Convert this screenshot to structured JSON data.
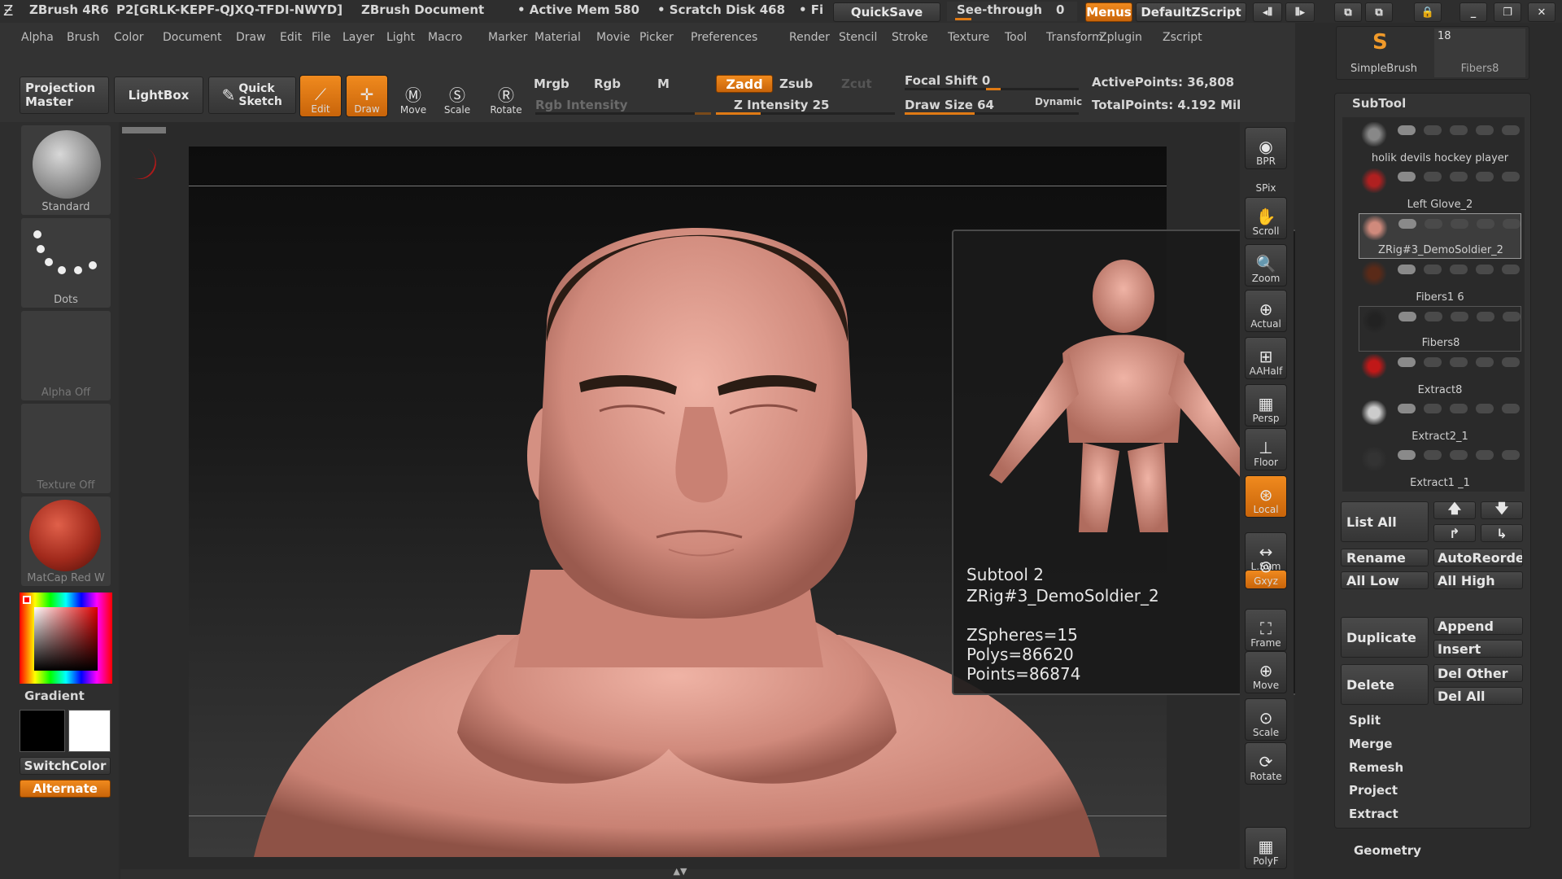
{
  "titlebar": {
    "app": "ZBrush 4R6",
    "serial": "P2[GRLK-KEPF-QJXQ-TFDI-NWYD]",
    "document": "ZBrush Document",
    "active_mem": "• Active Mem 580",
    "scratch": "• Scratch Disk 468",
    "fi": "• Fi",
    "quicksave": "QuickSave",
    "seethrough": "See-through",
    "seethrough_val": "0",
    "menus": "Menus",
    "script": "DefaultZScript"
  },
  "menubar": [
    "Alpha",
    "Brush",
    "Color",
    "Document",
    "Draw",
    "Edit",
    "File",
    "Layer",
    "Light",
    "Macro",
    "Marker",
    "Material",
    "Movie",
    "Picker",
    "Preferences",
    "Render",
    "Stencil",
    "Stroke",
    "Texture",
    "Tool",
    "Transform",
    "Zplugin",
    "Zscript"
  ],
  "toolbar": {
    "projection_master": "Projection Master",
    "lightbox": "LightBox",
    "quick_sketch": "Quick Sketch",
    "edit": "Edit",
    "draw": "Draw",
    "move": "Move",
    "scale": "Scale",
    "rotate": "Rotate",
    "mrgb": "Mrgb",
    "rgb": "Rgb",
    "m": "M",
    "rgb_intensity": "Rgb Intensity",
    "zadd": "Zadd",
    "zsub": "Zsub",
    "zcut": "Zcut",
    "z_intensity": "Z Intensity 25",
    "focal_shift": "Focal Shift 0",
    "draw_size": "Draw Size 64",
    "dynamic": "Dynamic",
    "active_points": "ActivePoints: 36,808",
    "total_points": "TotalPoints: 4.192 Mil",
    "z_intensity_level": 0.25,
    "draw_size_level": 0.4
  },
  "leftshelf": {
    "brush": "Standard",
    "stroke": "Dots",
    "alpha": "Alpha Off",
    "texture": "Texture Off",
    "material": "MatCap Red W",
    "gradient": "Gradient",
    "switchcolor": "SwitchColor",
    "alternate": "Alternate"
  },
  "rightshelf": [
    "BPR",
    "SPix",
    "Scroll",
    "Zoom",
    "Actual",
    "AAHalf",
    "Persp",
    "Floor",
    "Local",
    "L.Sym",
    "Gxyz",
    "Frame",
    "Move",
    "Scale",
    "Rotate",
    "PolyF"
  ],
  "popup": {
    "line1": "Subtool 2",
    "line2": "ZRig#3_DemoSoldier_2",
    "line3": "ZSpheres=15",
    "line4": "Polys=86620",
    "line5": "Points=86874"
  },
  "toolpanel": {
    "simplebrush": "SimpleBrush",
    "fibers_count": "18",
    "fibers_thumb": "Fibers8"
  },
  "subtool": {
    "header": "SubTool",
    "items": [
      {
        "name": "holik devils hockey player"
      },
      {
        "name": "Left Glove_2"
      },
      {
        "name": "ZRig#3_DemoSoldier_2"
      },
      {
        "name": "Fibers1 6"
      },
      {
        "name": "Fibers8"
      },
      {
        "name": "Extract8"
      },
      {
        "name": "Extract2_1"
      },
      {
        "name": "Extract1 _1"
      }
    ],
    "list_all": "List All",
    "rename": "Rename",
    "autoreorder": "AutoReorde",
    "all_low": "All Low",
    "all_high": "All High",
    "duplicate": "Duplicate",
    "append": "Append",
    "insert": "Insert",
    "delete": "Delete",
    "del_other": "Del Other",
    "del_all": "Del All",
    "split": "Split",
    "merge": "Merge",
    "remesh": "Remesh",
    "project": "Project",
    "extract": "Extract",
    "geometry": "Geometry"
  },
  "colors": {
    "accent": "#e07a14",
    "skin": "#d9988b",
    "hair": "#2a1c14"
  }
}
